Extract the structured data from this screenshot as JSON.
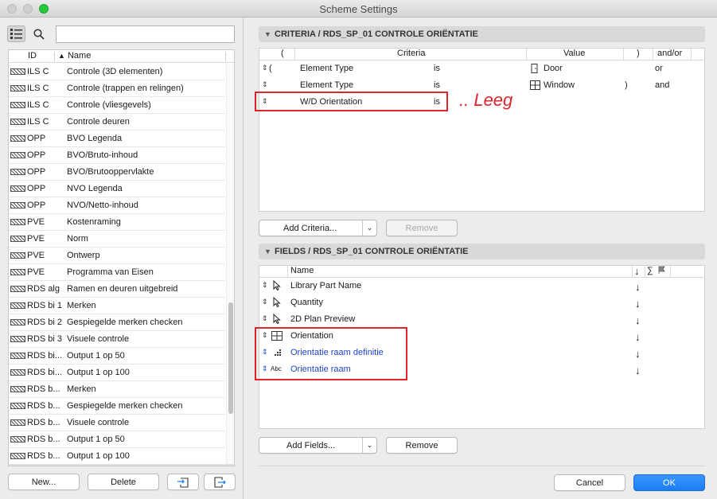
{
  "window": {
    "title": "Scheme Settings"
  },
  "left": {
    "search": {
      "value": "",
      "placeholder": ""
    },
    "columns": {
      "id": "ID",
      "name": "Name"
    },
    "rows": [
      {
        "id": "ILS C",
        "name": "Controle (3D elementen)"
      },
      {
        "id": "ILS C",
        "name": "Controle (trappen en relingen)"
      },
      {
        "id": "ILS C",
        "name": "Controle (vliesgevels)"
      },
      {
        "id": "ILS C",
        "name": "Controle deuren"
      },
      {
        "id": "OPP",
        "name": "BVO Legenda"
      },
      {
        "id": "OPP",
        "name": "BVO/Bruto-inhoud"
      },
      {
        "id": "OPP",
        "name": "BVO/Brutooppervlakte"
      },
      {
        "id": "OPP",
        "name": "NVO Legenda"
      },
      {
        "id": "OPP",
        "name": "NVO/Netto-inhoud"
      },
      {
        "id": "PVE",
        "name": "Kostenraming"
      },
      {
        "id": "PVE",
        "name": "Norm"
      },
      {
        "id": "PVE",
        "name": "Ontwerp"
      },
      {
        "id": "PVE",
        "name": "Programma van Eisen"
      },
      {
        "id": "RDS alg",
        "name": "Ramen en deuren uitgebreid"
      },
      {
        "id": "RDS bi 1",
        "name": "Merken"
      },
      {
        "id": "RDS bi 2",
        "name": "Gespiegelde merken checken"
      },
      {
        "id": "RDS bi 3",
        "name": "Visuele controle"
      },
      {
        "id": "RDS bi...",
        "name": "Output 1 op  50"
      },
      {
        "id": "RDS bi...",
        "name": "Output 1 op 100"
      },
      {
        "id": "RDS b...",
        "name": "Merken"
      },
      {
        "id": "RDS b...",
        "name": "Gespiegelde merken checken"
      },
      {
        "id": "RDS b...",
        "name": "Visuele controle"
      },
      {
        "id": "RDS b...",
        "name": "Output 1 op  50"
      },
      {
        "id": "RDS b...",
        "name": "Output 1 op 100"
      }
    ],
    "buttons": {
      "new": "New...",
      "delete": "Delete"
    }
  },
  "criteria": {
    "title": "CRITERIA / RDS_SP_01 CONTROLE ORIËNTATIE",
    "headers": {
      "open": "(",
      "criteria": "Criteria",
      "value": "Value",
      "close": ")",
      "andor": "and/or"
    },
    "rows": [
      {
        "open": "(",
        "element": "Element Type",
        "op": "is",
        "value": "Door",
        "value_icon": "door-icon",
        "close": "",
        "andor": "or"
      },
      {
        "open": "",
        "element": "Element Type",
        "op": "is",
        "value": "Window",
        "value_icon": "window-icon",
        "close": ")",
        "andor": "and"
      },
      {
        "open": "",
        "element": "W/D Orientation",
        "op": "is",
        "value": "",
        "value_icon": "",
        "close": "",
        "andor": ""
      }
    ],
    "annotation": ".. Leeg",
    "add_label": "Add Criteria...",
    "remove_label": "Remove"
  },
  "fields": {
    "title": "FIELDS / RDS_SP_01 CONTROLE ORIËNTATIE",
    "headers": {
      "name": "Name",
      "sort": "↓",
      "sum": "∑"
    },
    "rows": [
      {
        "name": "Library Part Name",
        "icon": "pointer-icon",
        "custom": false
      },
      {
        "name": "Quantity",
        "icon": "pointer-icon",
        "custom": false
      },
      {
        "name": "2D Plan Preview",
        "icon": "pointer-icon",
        "custom": false
      },
      {
        "name": "Orientation",
        "icon": "window-icon",
        "custom": false
      },
      {
        "name": "Orientatie raam definitie",
        "icon": "grid-dots-icon",
        "custom": true
      },
      {
        "name": "Orientatie raam",
        "icon": "abc-text-icon",
        "icon_text": "Abc",
        "custom": true
      }
    ],
    "add_label": "Add Fields...",
    "remove_label": "Remove"
  },
  "footer": {
    "cancel": "Cancel",
    "ok": "OK"
  },
  "colors": {
    "accent": "#1b7ef5",
    "annotation": "#e0232b",
    "custom_field": "#1d44c6"
  }
}
